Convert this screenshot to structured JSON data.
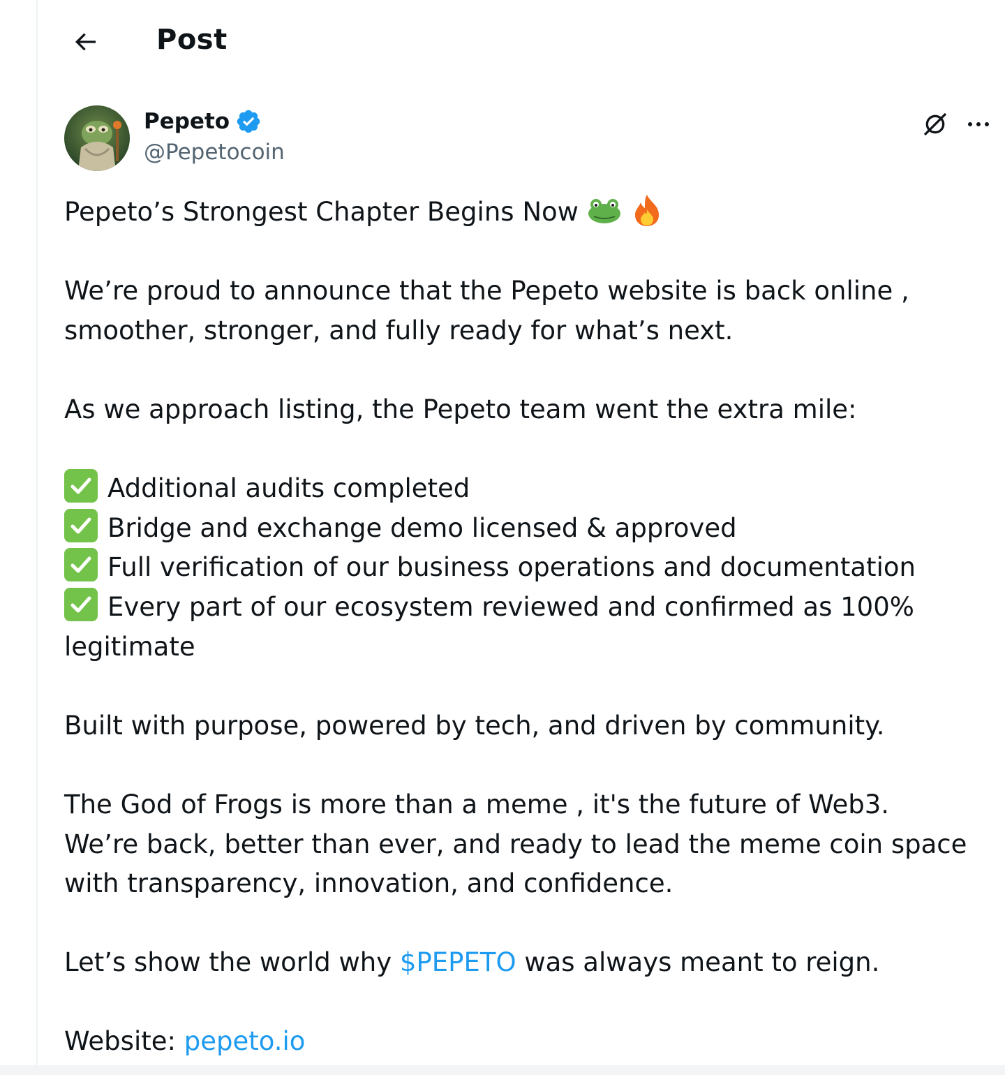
{
  "header": {
    "title": "Post"
  },
  "post": {
    "author": {
      "display_name": "Pepeto",
      "handle": "@Pepetocoin"
    },
    "title_line": "Pepeto’s Strongest Chapter Begins Now",
    "title_emojis": [
      "frog-emoji",
      "fire-emoji"
    ],
    "para1": {
      "line1": "We’re proud to announce that the Pepeto website is back online ,",
      "line2": "smoother, stronger, and fully ready for what’s next."
    },
    "para2": "As we approach listing, the Pepeto team went the extra mile:",
    "checklist": [
      "Additional audits completed",
      "Bridge and exchange demo licensed & approved",
      "Full verification of our business operations and documentation",
      "Every part of our ecosystem reviewed and confirmed as 100%"
    ],
    "checklist_wrap": "legitimate",
    "para3": "Built with purpose, powered by tech, and driven by community.",
    "para4": {
      "line1": "The God of Frogs is more than a meme , it's the future of Web3.",
      "line2": "We’re back, better than ever, and ready to lead the meme coin space",
      "line3": "with transparency, innovation, and confidence."
    },
    "para5": {
      "prefix": "Let’s show the world why ",
      "cashtag": "$PEPETO",
      "suffix": " was always meant to reign."
    },
    "website": {
      "label": "Website: ",
      "link": "pepeto.io"
    }
  },
  "colors": {
    "link": "#1d9bf0",
    "verified": "#1d9bf0",
    "check_box": "#73c34a",
    "text": "#0f1419",
    "muted": "#536471"
  },
  "icons": [
    "back-arrow-icon",
    "verified-badge-icon",
    "grok-icon",
    "more-icon",
    "check-mark-icon"
  ]
}
